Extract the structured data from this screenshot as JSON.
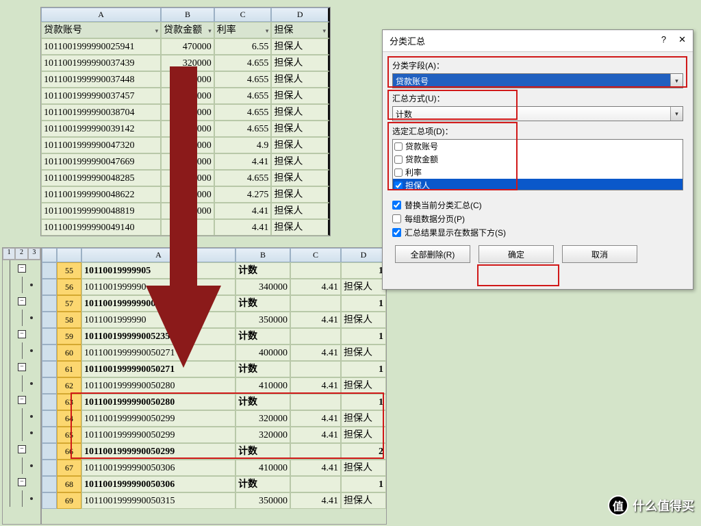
{
  "sheet1": {
    "cols": [
      "A",
      "B",
      "C",
      "D"
    ],
    "headers": [
      "贷款账号",
      "贷款金额",
      "利率",
      "担保"
    ],
    "rows": [
      [
        "1011001999990025941",
        "470000",
        "6.55",
        "担保人"
      ],
      [
        "1011001999990037439",
        "320000",
        "4.655",
        "担保人"
      ],
      [
        "1011001999990037448",
        "280000",
        "4.655",
        "担保人"
      ],
      [
        "1011001999990037457",
        "50000",
        "4.655",
        "担保人"
      ],
      [
        "1011001999990038704",
        "00000",
        "4.655",
        "担保人"
      ],
      [
        "1011001999990039142",
        "00000",
        "4.655",
        "担保人"
      ],
      [
        "1011001999990047320",
        "00000",
        "4.9",
        "担保人"
      ],
      [
        "1011001999990047669",
        "00000",
        "4.41",
        "担保人"
      ],
      [
        "1011001999990048285",
        "60000",
        "4.655",
        "担保人"
      ],
      [
        "1011001999990048622",
        "00000",
        "4.275",
        "担保人"
      ],
      [
        "1011001999990048819",
        "0000",
        "4.41",
        "担保人"
      ],
      [
        "1011001999990049140",
        "",
        "4.41",
        "担保人"
      ]
    ]
  },
  "sheet2": {
    "cols": [
      "",
      "",
      "A",
      "B",
      "C",
      "D"
    ],
    "rows": [
      {
        "n": 55,
        "a": "1011001999990",
        "cut": "5",
        "b": "计数",
        "c": "",
        "d": "1",
        "bold": true
      },
      {
        "n": 56,
        "a": "1011001999990",
        "b": "340000",
        "c": "4.41",
        "d": "担保人",
        "bold": false
      },
      {
        "n": 57,
        "a": "101100199999900",
        "cut": "26",
        "b": "计数",
        "c": "",
        "d": "1",
        "bold": true
      },
      {
        "n": 58,
        "a": "1011001999990",
        "b": "350000",
        "c": "4.41",
        "d": "担保人",
        "bold": false
      },
      {
        "n": 59,
        "a": "10110019999900",
        "cut": "5235",
        "b": "计数",
        "c": "",
        "d": "1",
        "bold": true
      },
      {
        "n": 60,
        "a": "1011001999990050271",
        "b": "400000",
        "c": "4.41",
        "d": "担保人",
        "bold": false
      },
      {
        "n": 61,
        "a": "1011001999990050271",
        "b": "计数",
        "c": "",
        "d": "1",
        "bold": true
      },
      {
        "n": 62,
        "a": "1011001999990050280",
        "b": "410000",
        "c": "4.41",
        "d": "担保人",
        "bold": false
      },
      {
        "n": 63,
        "a": "1011001999990050280",
        "b": "计数",
        "c": "",
        "d": "1",
        "bold": true
      },
      {
        "n": 64,
        "a": "1011001999990050299",
        "b": "320000",
        "c": "4.41",
        "d": "担保人",
        "bold": false
      },
      {
        "n": 65,
        "a": "1011001999990050299",
        "b": "320000",
        "c": "4.41",
        "d": "担保人",
        "bold": false
      },
      {
        "n": 66,
        "a": "1011001999990050299",
        "b": "计数",
        "c": "",
        "d": "2",
        "bold": true
      },
      {
        "n": 67,
        "a": "1011001999990050306",
        "b": "410000",
        "c": "4.41",
        "d": "担保人",
        "bold": false
      },
      {
        "n": 68,
        "a": "1011001999990050306",
        "b": "计数",
        "c": "",
        "d": "1",
        "bold": true
      },
      {
        "n": 69,
        "a": "1011001999990050315",
        "b": "350000",
        "c": "4.41",
        "d": "担保人",
        "bold": false
      }
    ]
  },
  "outline_nums": [
    "1",
    "2",
    "3"
  ],
  "dialog": {
    "title": "分类汇总",
    "help": "?",
    "close": "✕",
    "field_label": "分类字段(A)：",
    "field_value": "贷款账号",
    "method_label": "汇总方式(U)：",
    "method_value": "计数",
    "items_label": "选定汇总项(D)：",
    "items": [
      {
        "label": "贷款账号",
        "checked": false
      },
      {
        "label": "贷款金额",
        "checked": false
      },
      {
        "label": "利率",
        "checked": false
      },
      {
        "label": "担保人",
        "checked": true
      }
    ],
    "opt1": "替换当前分类汇总(C)",
    "opt2": "每组数据分页(P)",
    "opt3": "汇总结果显示在数据下方(S)",
    "btn_delete": "全部删除(R)",
    "btn_ok": "确定",
    "btn_cancel": "取消"
  },
  "watermark": "什么值得买"
}
